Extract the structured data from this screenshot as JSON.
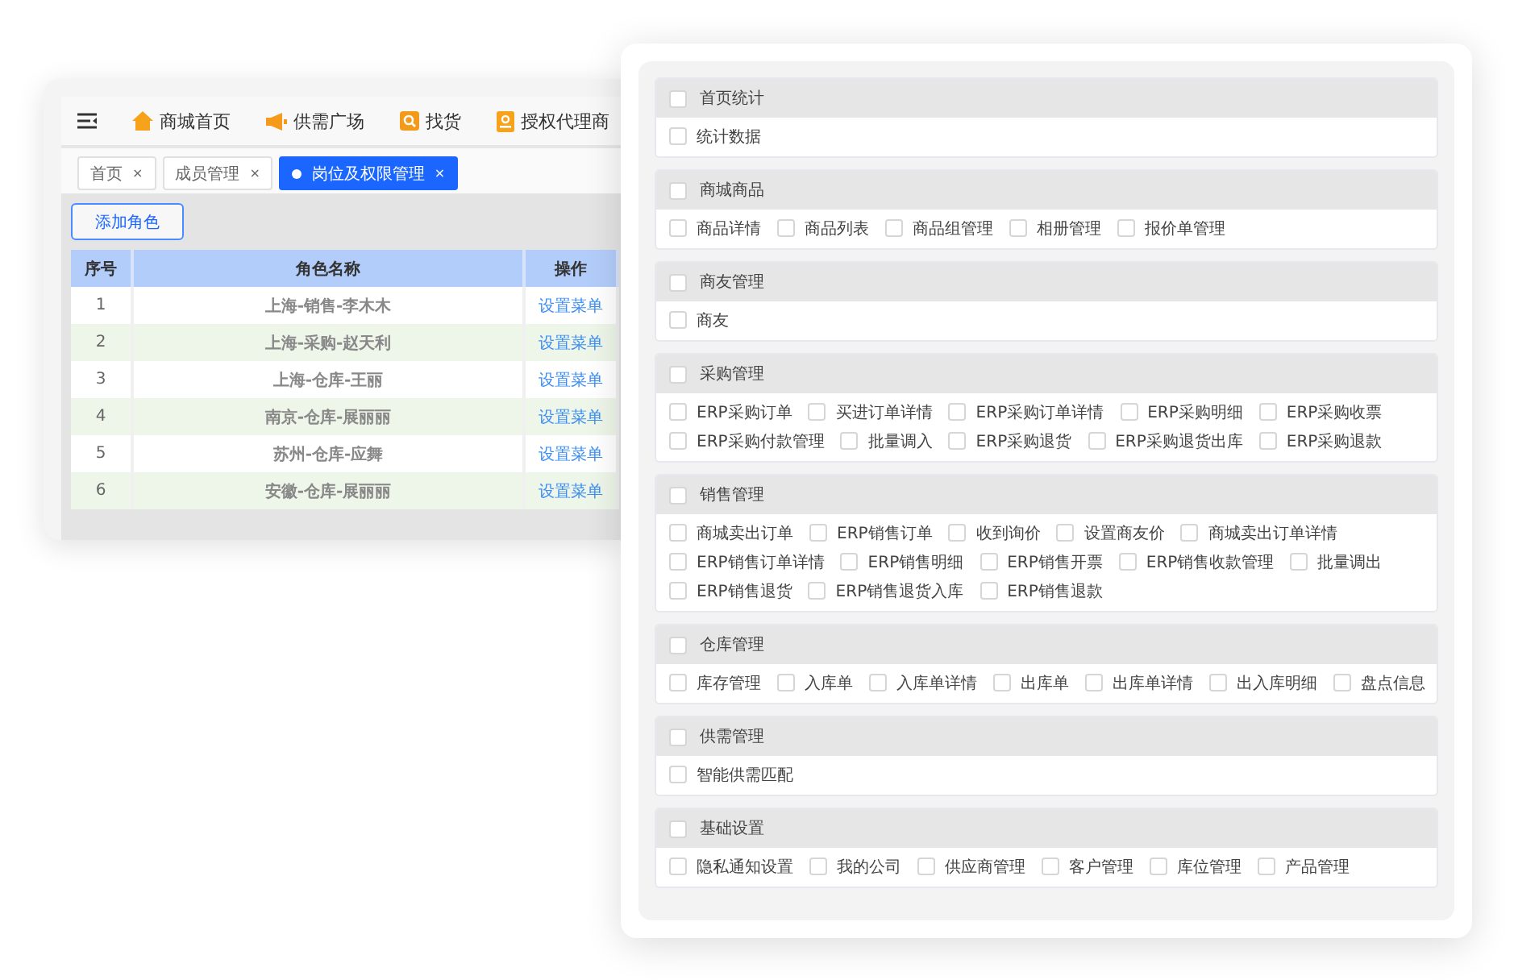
{
  "back_window": {
    "nav": [
      {
        "label": "商城首页",
        "kind": "home"
      },
      {
        "label": "供需广场",
        "kind": "megaphone"
      },
      {
        "label": "找货",
        "kind": "search"
      },
      {
        "label": "授权代理商",
        "kind": "book"
      }
    ],
    "tabs": [
      {
        "label": "首页",
        "close": "×",
        "selected": false
      },
      {
        "label": "成员管理",
        "close": "×",
        "selected": false
      },
      {
        "label": "岗位及权限管理",
        "close": "×",
        "selected": true
      }
    ],
    "add_button": "添加角色",
    "table": {
      "columns": [
        "序号",
        "角色名称",
        "操作"
      ],
      "rows": [
        {
          "index": "1",
          "name": "上海-销售-李木木",
          "action": "设置菜单"
        },
        {
          "index": "2",
          "name": "上海-采购-赵天利",
          "action": "设置菜单"
        },
        {
          "index": "3",
          "name": "上海-仓库-王丽",
          "action": "设置菜单"
        },
        {
          "index": "4",
          "name": "南京-仓库-展丽丽",
          "action": "设置菜单"
        },
        {
          "index": "5",
          "name": "苏州-仓库-应舞",
          "action": "设置菜单"
        },
        {
          "index": "6",
          "name": "安徽-仓库-展丽丽",
          "action": "设置菜单"
        }
      ]
    }
  },
  "permissions": [
    {
      "title": "首页统计",
      "checked": false,
      "items": [
        {
          "label": "统计数据",
          "checked": false
        }
      ]
    },
    {
      "title": "商城商品",
      "checked": false,
      "items": [
        {
          "label": "商品详情",
          "checked": false
        },
        {
          "label": "商品列表",
          "checked": false
        },
        {
          "label": "商品组管理",
          "checked": false
        },
        {
          "label": "相册管理",
          "checked": false
        },
        {
          "label": "报价单管理",
          "checked": false
        }
      ]
    },
    {
      "title": "商友管理",
      "checked": false,
      "items": [
        {
          "label": "商友",
          "checked": false
        }
      ]
    },
    {
      "title": "采购管理",
      "checked": false,
      "items": [
        {
          "label": "ERP采购订单",
          "checked": false
        },
        {
          "label": "买进订单详情",
          "checked": false
        },
        {
          "label": "ERP采购订单详情",
          "checked": false
        },
        {
          "label": "ERP采购明细",
          "checked": false
        },
        {
          "label": "ERP采购收票",
          "checked": false
        },
        {
          "label": "ERP采购付款管理",
          "checked": false
        },
        {
          "label": "批量调入",
          "checked": false
        },
        {
          "label": "ERP采购退货",
          "checked": false
        },
        {
          "label": "ERP采购退货出库",
          "checked": false
        },
        {
          "label": "ERP采购退款",
          "checked": false
        }
      ]
    },
    {
      "title": "销售管理",
      "checked": false,
      "items": [
        {
          "label": "商城卖出订单",
          "checked": false
        },
        {
          "label": "ERP销售订单",
          "checked": false
        },
        {
          "label": "收到询价",
          "checked": false
        },
        {
          "label": "设置商友价",
          "checked": false
        },
        {
          "label": "商城卖出订单详情",
          "checked": false
        },
        {
          "label": "ERP销售订单详情",
          "checked": false
        },
        {
          "label": "ERP销售明细",
          "checked": false
        },
        {
          "label": "ERP销售开票",
          "checked": false
        },
        {
          "label": "ERP销售收款管理",
          "checked": false
        },
        {
          "label": "批量调出",
          "checked": false
        },
        {
          "label": "ERP销售退货",
          "checked": false
        },
        {
          "label": "ERP销售退货入库",
          "checked": false
        },
        {
          "label": "ERP销售退款",
          "checked": false
        }
      ]
    },
    {
      "title": "仓库管理",
      "checked": false,
      "items": [
        {
          "label": "库存管理",
          "checked": false
        },
        {
          "label": "入库单",
          "checked": false
        },
        {
          "label": "入库单详情",
          "checked": false
        },
        {
          "label": "出库单",
          "checked": false
        },
        {
          "label": "出库单详情",
          "checked": false
        },
        {
          "label": "出入库明细",
          "checked": false
        },
        {
          "label": "盘点信息",
          "checked": false
        }
      ]
    },
    {
      "title": "供需管理",
      "checked": false,
      "items": [
        {
          "label": "智能供需匹配",
          "checked": false
        }
      ]
    },
    {
      "title": "基础设置",
      "checked": false,
      "items": [
        {
          "label": "隐私通知设置",
          "checked": false
        },
        {
          "label": "我的公司",
          "checked": false
        },
        {
          "label": "供应商管理",
          "checked": false
        },
        {
          "label": "客户管理",
          "checked": false
        },
        {
          "label": "库位管理",
          "checked": false
        },
        {
          "label": "产品管理",
          "checked": false
        }
      ]
    }
  ]
}
